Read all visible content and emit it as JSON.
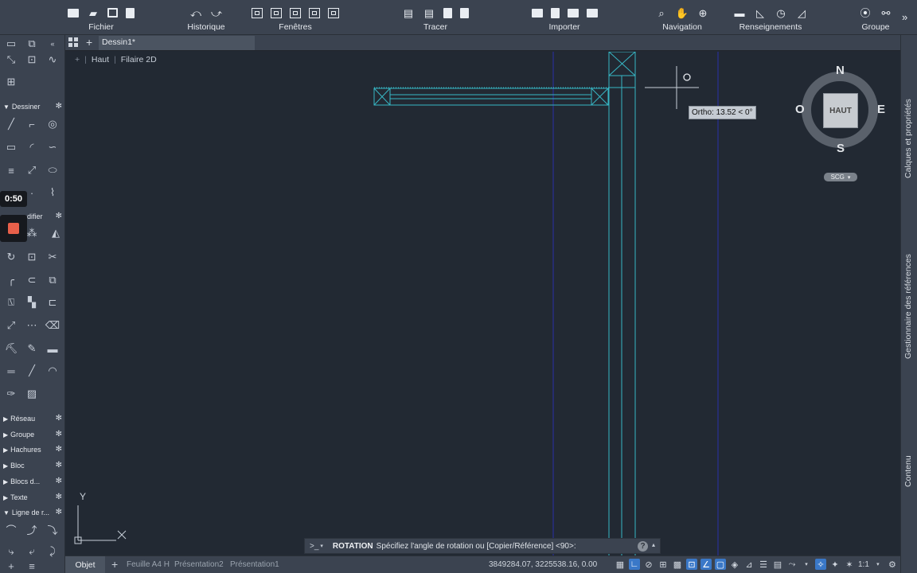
{
  "ribbon": {
    "groups": [
      {
        "id": "fichier",
        "label": "Fichier"
      },
      {
        "id": "historique",
        "label": "Historique"
      },
      {
        "id": "fenetres",
        "label": "Fenêtres"
      },
      {
        "id": "tracer",
        "label": "Tracer"
      },
      {
        "id": "importer",
        "label": "Importer"
      },
      {
        "id": "navigation",
        "label": "Navigation"
      },
      {
        "id": "renseignements",
        "label": "Renseignements"
      },
      {
        "id": "groupe",
        "label": "Groupe"
      }
    ],
    "expand_icon": "»"
  },
  "tabs": {
    "new_tab": "+",
    "active": "Dessin1*"
  },
  "viewport": {
    "view_label": "Haut",
    "style_label": "Filaire 2D"
  },
  "palette": {
    "sections": {
      "dessiner": "Dessiner",
      "modifier": "difier",
      "reseau": "Réseau",
      "groupe": "Groupe",
      "hachures": "Hachures",
      "bloc": "Bloc",
      "blocs_dyn": "Blocs d...",
      "texte": "Texte",
      "ligne_ref": "Ligne de r..."
    },
    "timer": "0:50"
  },
  "viewcube": {
    "north": "N",
    "south": "S",
    "east": "E",
    "west": "O",
    "face": "HAUT",
    "ucs": "SCG"
  },
  "cursor": {
    "tooltip": "Ortho: 13.52 < 0°"
  },
  "ucs_icon": {
    "y_label": "Y"
  },
  "command": {
    "prompt": ">_",
    "name": "ROTATION",
    "text": "Spécifiez l'angle de rotation ou [Copier/Référence] <90>:"
  },
  "layout_tabs": [
    "Objet",
    "Feuille A4 H",
    "Présentation2",
    "Présentation1"
  ],
  "status": {
    "coords": "3849284.07, 3225538.16, 0.00",
    "scale": "1:1"
  },
  "right_panels": [
    "Calques et propriétés",
    "Gestionnaire des références",
    "Contenu"
  ],
  "colors": {
    "ribbon_bg": "#3b4350",
    "canvas_bg": "#222933",
    "cyan_lines": "#37b6c4",
    "blue_lines": "#2a2fa8",
    "record_button": "#e8604a",
    "active_status": "#3a78c8"
  }
}
